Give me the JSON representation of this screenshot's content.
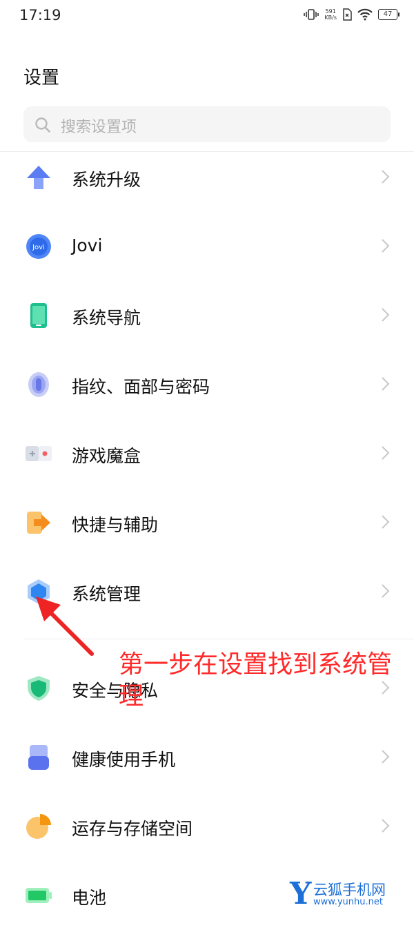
{
  "status_bar": {
    "time": "17:19",
    "net_speed_value": "591",
    "net_speed_unit": "KB/s",
    "battery": "47"
  },
  "header": {
    "title": "设置"
  },
  "search": {
    "placeholder": "搜索设置项"
  },
  "items": [
    {
      "label": "系统升级",
      "icon": "upgrade-arrow-icon"
    },
    {
      "label": "Jovi",
      "icon": "jovi-icon",
      "icon_text": "Jovi"
    },
    {
      "label": "系统导航",
      "icon": "phone-navigation-icon"
    },
    {
      "label": "指纹、面部与密码",
      "icon": "fingerprint-icon"
    },
    {
      "label": "游戏魔盒",
      "icon": "game-controller-icon"
    },
    {
      "label": "快捷与辅助",
      "icon": "shortcut-arrow-icon"
    },
    {
      "label": "系统管理",
      "icon": "hexagon-icon"
    },
    {
      "label": "安全与隐私",
      "icon": "shield-icon"
    },
    {
      "label": "健康使用手机",
      "icon": "hourglass-icon"
    },
    {
      "label": "运存与存储空间",
      "icon": "pie-chart-icon"
    },
    {
      "label": "电池",
      "icon": "battery-icon"
    }
  ],
  "annotation": {
    "text": "第一步在设置找到系统管理",
    "color": "#ff2a2a"
  },
  "watermark": {
    "letter": "Y",
    "name": "云狐手机网",
    "url": "www.yunhu.net"
  }
}
